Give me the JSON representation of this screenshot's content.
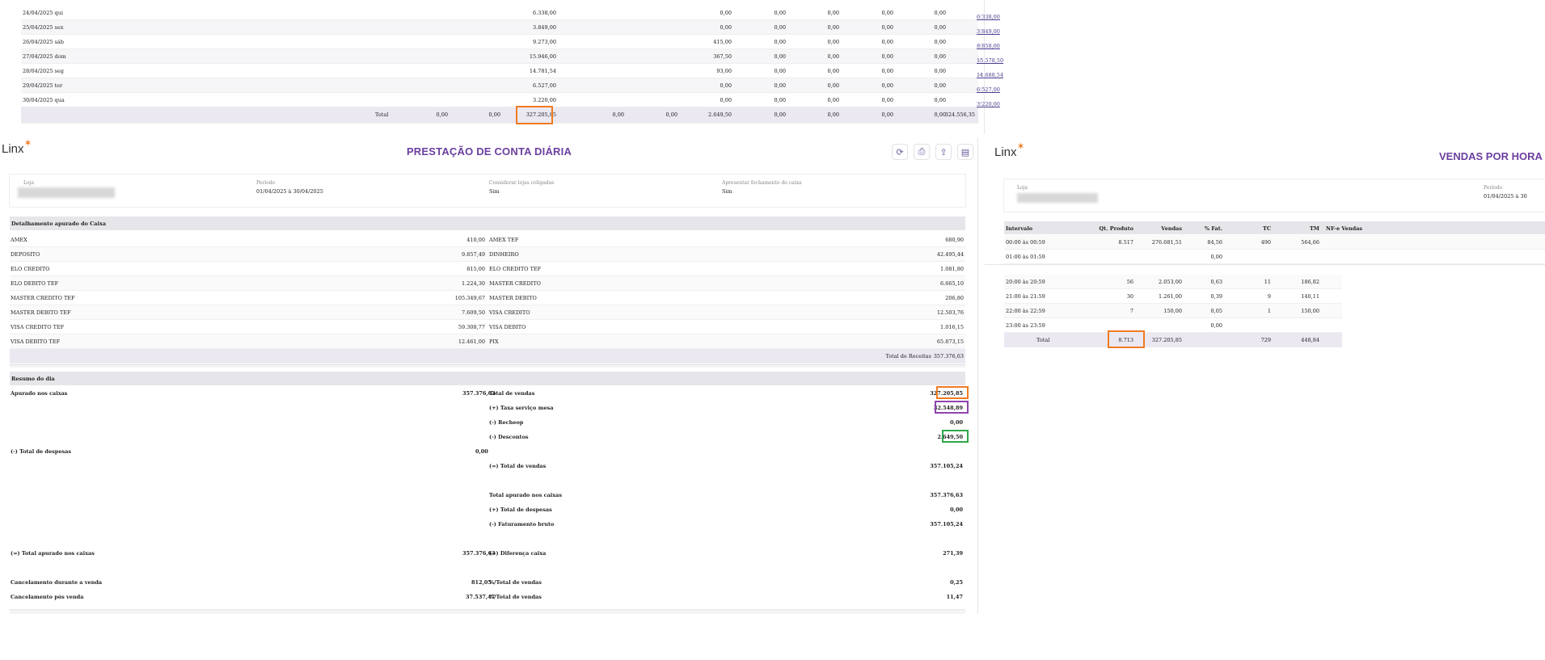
{
  "top_table": {
    "rows": [
      {
        "date": "24/04/2025 qui",
        "v1": "6.338,00",
        "v2": "0,00",
        "v3": "0,00",
        "v4": "0,00",
        "v5": "0,00",
        "v6": "0,00",
        "total": "6.338,00"
      },
      {
        "date": "25/04/2025 sex",
        "v1": "3.849,00",
        "v2": "0,00",
        "v3": "0,00",
        "v4": "0,00",
        "v5": "0,00",
        "v6": "0,00",
        "total": "3.849,00"
      },
      {
        "date": "26/04/2025 sáb",
        "v1": "9.273,00",
        "v2": "415,00",
        "v3": "0,00",
        "v4": "0,00",
        "v5": "0,00",
        "v6": "0,00",
        "total": "8.858,00"
      },
      {
        "date": "27/04/2025 dom",
        "v1": "15.946,00",
        "v2": "367,50",
        "v3": "0,00",
        "v4": "0,00",
        "v5": "0,00",
        "v6": "0,00",
        "total": "15.578,50"
      },
      {
        "date": "28/04/2025 seg",
        "v1": "14.781,54",
        "v2": "93,00",
        "v3": "0,00",
        "v4": "0,00",
        "v5": "0,00",
        "v6": "0,00",
        "total": "14.688,54"
      },
      {
        "date": "29/04/2025 ter",
        "v1": "6.527,00",
        "v2": "0,00",
        "v3": "0,00",
        "v4": "0,00",
        "v5": "0,00",
        "v6": "0,00",
        "total": "6.527,00"
      },
      {
        "date": "30/04/2025 qua",
        "v1": "3.220,00",
        "v2": "0,00",
        "v3": "0,00",
        "v4": "0,00",
        "v5": "0,00",
        "v6": "0,00",
        "total": "3.220,00"
      }
    ],
    "total_row": {
      "label": "Total",
      "a": "0,00",
      "b": "0,00",
      "c": "327.205,85",
      "d": "0,00",
      "e": "0,00",
      "f": "2.649,50",
      "g": "0,00",
      "h": "0,00",
      "i": "0,00",
      "j": "0,00",
      "total": "324.556,35"
    }
  },
  "main": {
    "logo": "Linx",
    "title": "PRESTAÇÃO DE CONTA DIÁRIA",
    "filters": {
      "loja_label": "Loja",
      "periodo_label": "Período",
      "periodo_value": "01/04/2025 à 30/04/2025",
      "coligadas_label": "Considerar lojas coligadas",
      "coligadas_value": "Sim",
      "fechamento_label": "Apresentar fechamento do caixa",
      "fechamento_value": "Sim"
    },
    "detail_section": "Detalhamento apurado do Caixa",
    "detail_rows": [
      {
        "l": "AMEX",
        "lv": "410,00",
        "r": "AMEX TEF",
        "rv": "680,90"
      },
      {
        "l": "DEPOSITO",
        "lv": "9.857,49",
        "r": "DINHEIRO",
        "rv": "42.495,44"
      },
      {
        "l": "ELO CREDITO",
        "lv": "815,00",
        "r": "ELO CREDITO TEF",
        "rv": "1.081,80"
      },
      {
        "l": "ELO DEBITO TEF",
        "lv": "1.224,30",
        "r": "MASTER CREDITO",
        "rv": "6.665,10"
      },
      {
        "l": "MASTER CREDITO TEF",
        "lv": "105.349,67",
        "r": "MASTER DEBITO",
        "rv": "206,80"
      },
      {
        "l": "MASTER DEBITO TEF",
        "lv": "7.609,50",
        "r": "VISA CREDITO",
        "rv": "12.503,76"
      },
      {
        "l": "VISA CREDITO TEF",
        "lv": "59.308,77",
        "r": "VISA DEBITO",
        "rv": "1.016,15"
      },
      {
        "l": "VISA DEBITO TEF",
        "lv": "12.461,00",
        "r": "PIX",
        "rv": "65.873,15"
      }
    ],
    "total_receitas_label": "Total de Receitas",
    "total_receitas_value": "357.376,63",
    "resumo_section": "Resumo do dia",
    "resumo": {
      "apurado_label": "Apurado nos caixas",
      "apurado_value": "357.376,63",
      "total_vendas_label": "Total de vendas",
      "total_vendas_value": "327.205,85",
      "taxa_label": "(+) Taxa serviço mesa",
      "taxa_value": "32.548,89",
      "recheop_label": "(-) Recheop",
      "recheop_value": "0,00",
      "descontos_label": "(-) Descontos",
      "descontos_value": "2.649,50",
      "despesas_label": "(-) Total de despesas",
      "despesas_value": "0,00",
      "eq_vendas_label": "(=) Total de vendas",
      "eq_vendas_value": "357.105,24",
      "total_apurado_label": "Total apurado nos caixas",
      "total_apurado_value": "357.376,63",
      "total_despesas2_label": "(+) Total de despesas",
      "total_despesas2_value": "0,00",
      "faturamento_label": "(-) Faturamento bruto",
      "faturamento_value": "357.105,24",
      "eq_total_apurado_label": "(=) Total apurado nos caixas",
      "eq_total_apurado_value": "357.376,63",
      "diferenca_label": "(=) Diferença caixa",
      "diferenca_value": "271,39",
      "canc_durante_label": "Cancelamento durante a venda",
      "canc_durante_value": "812,05",
      "pct_vendas1_label": "%/Total de vendas",
      "pct_vendas1_value": "0,25",
      "canc_pos_label": "Cancelamento pós venda",
      "canc_pos_value": "37.537,47",
      "pct_vendas2_label": "%/Total de vendas",
      "pct_vendas2_value": "11,47"
    },
    "icons": [
      "refresh-icon",
      "print-icon",
      "export-icon",
      "printer-icon"
    ]
  },
  "right": {
    "logo": "Linx",
    "title": "VENDAS POR HORA",
    "loja_label": "Loja",
    "periodo_label": "Período",
    "periodo_value": "01/04/2025 à 30",
    "headers": [
      "Intervalo",
      "Qt. Produto",
      "Vendas",
      "% Fat.",
      "TC",
      "TM",
      "NF-e Vendas"
    ],
    "rows_a": [
      {
        "int": "00:00 às 00:59",
        "qt": "8.517",
        "v": "276.681,51",
        "pct": "84,56",
        "tc": "490",
        "tm": "564,66"
      },
      {
        "int": "01:00 às 01:59",
        "qt": "",
        "v": "",
        "pct": "0,00",
        "tc": "",
        "tm": ""
      }
    ],
    "rows_b": [
      {
        "int": "20:00 às 20:59",
        "qt": "56",
        "v": "2.053,00",
        "pct": "0,63",
        "tc": "11",
        "tm": "186,82"
      },
      {
        "int": "21:00 às 21:59",
        "qt": "30",
        "v": "1.261,00",
        "pct": "0,39",
        "tc": "9",
        "tm": "140,11"
      },
      {
        "int": "22:00 às 22:59",
        "qt": "7",
        "v": "150,00",
        "pct": "0,05",
        "tc": "1",
        "tm": "150,00"
      },
      {
        "int": "23:00 às 23:59",
        "qt": "",
        "v": "",
        "pct": "0,00",
        "tc": "",
        "tm": ""
      }
    ],
    "total": {
      "label": "Total",
      "qt": "8.713",
      "v": "327.205,85",
      "tc": "729",
      "tm": "448,84"
    }
  },
  "colors": {
    "accent": "#6b3fa0",
    "orange": "#f07b22",
    "purple": "#8e44ad",
    "green": "#2ea84a"
  }
}
